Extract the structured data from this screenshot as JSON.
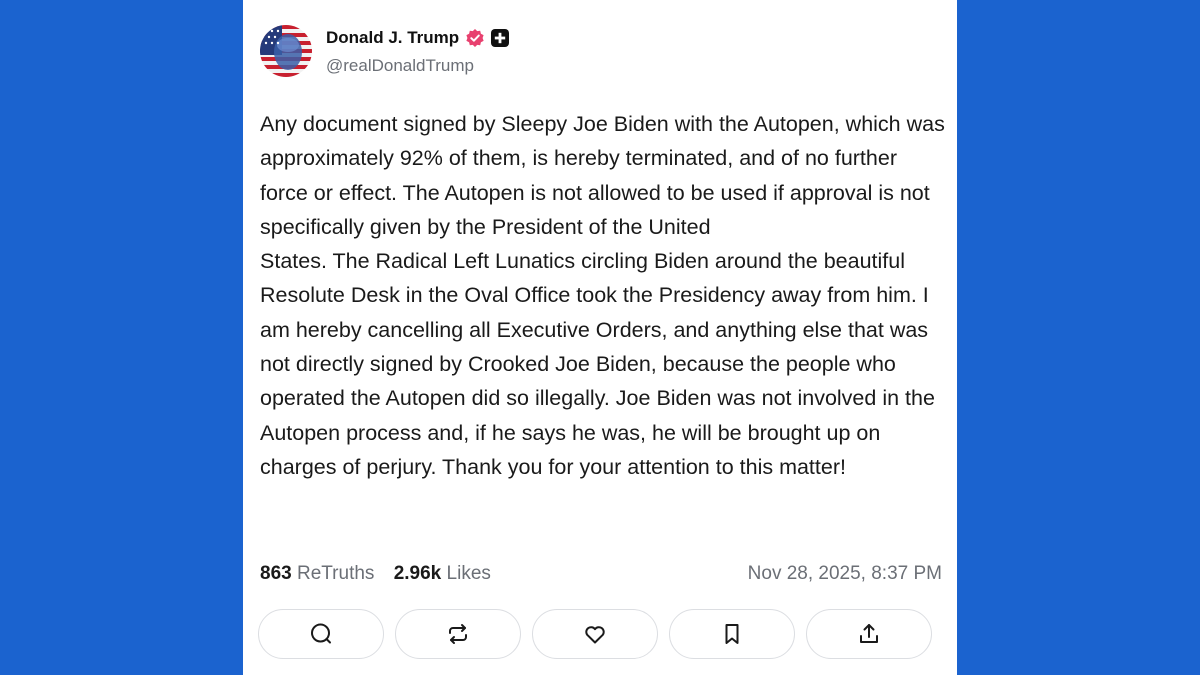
{
  "profile": {
    "display_name": "Donald J. Trump",
    "handle": "@realDonaldTrump",
    "verified_color": "#e8416f",
    "avatar_icon": "flag-portrait-avatar"
  },
  "post": {
    "paragraphs": [
      "Any document signed by Sleepy Joe Biden with the Autopen, which was approximately 92% of them, is hereby terminated, and of no further force or effect. The Autopen is not allowed to be used if approval is not specifically given by the President of the United",
      "States. The Radical Left Lunatics circling Biden around the beautiful Resolute Desk in the Oval Office took the Presidency away from him. I am hereby cancelling all Executive Orders, and anything else that was not directly signed by Crooked Joe Biden, because the people who operated the Autopen did so illegally. Joe Biden was not involved in the Autopen process and, if he says he was, he will be brought up on charges of perjury. Thank you for your attention to this matter!"
    ]
  },
  "stats": {
    "retruths_count": "863",
    "retruths_label": "ReTruths",
    "likes_count": "2.96k",
    "likes_label": "Likes",
    "timestamp": "Nov 28, 2025, 8:37 PM"
  },
  "actions": [
    {
      "icon": "reply-icon"
    },
    {
      "icon": "retruth-icon"
    },
    {
      "icon": "like-icon"
    },
    {
      "icon": "bookmark-icon"
    },
    {
      "icon": "share-icon"
    }
  ],
  "colors": {
    "background": "#1b63cf",
    "card": "#ffffff",
    "text": "#1a1a1a",
    "muted": "#6b6f76"
  }
}
